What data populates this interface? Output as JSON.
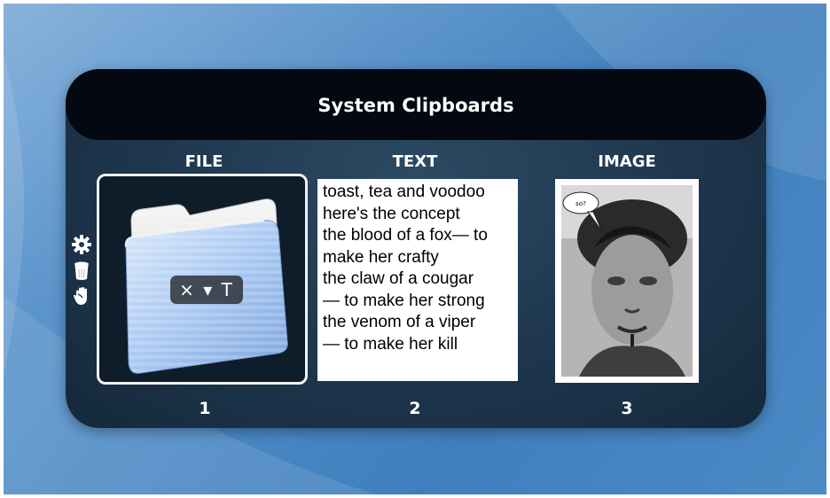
{
  "widget": {
    "title": "System Clipboards",
    "columns": [
      {
        "label": "FILE",
        "number": "1"
      },
      {
        "label": "TEXT",
        "number": "2"
      },
      {
        "label": "IMAGE",
        "number": "3"
      }
    ],
    "side_icons": [
      "gear-icon",
      "trash-icon",
      "hand-icon"
    ]
  },
  "file_slot": {
    "icon": "folder-icon",
    "badge": "× ▾ T"
  },
  "text_slot": {
    "lines": [
      "toast, tea and voodoo",
      "here's the concept",
      "the blood of a fox— to",
      "make her crafty",
      "the claw of a cougar",
      "— to make her strong",
      "the venom of a viper",
      "— to make her kill"
    ]
  },
  "image_slot": {
    "speech_bubble": "so?"
  },
  "colors": {
    "widget_bg": "#1f3850",
    "title_bar": "#040810",
    "desktop": "#4f8cc6"
  }
}
